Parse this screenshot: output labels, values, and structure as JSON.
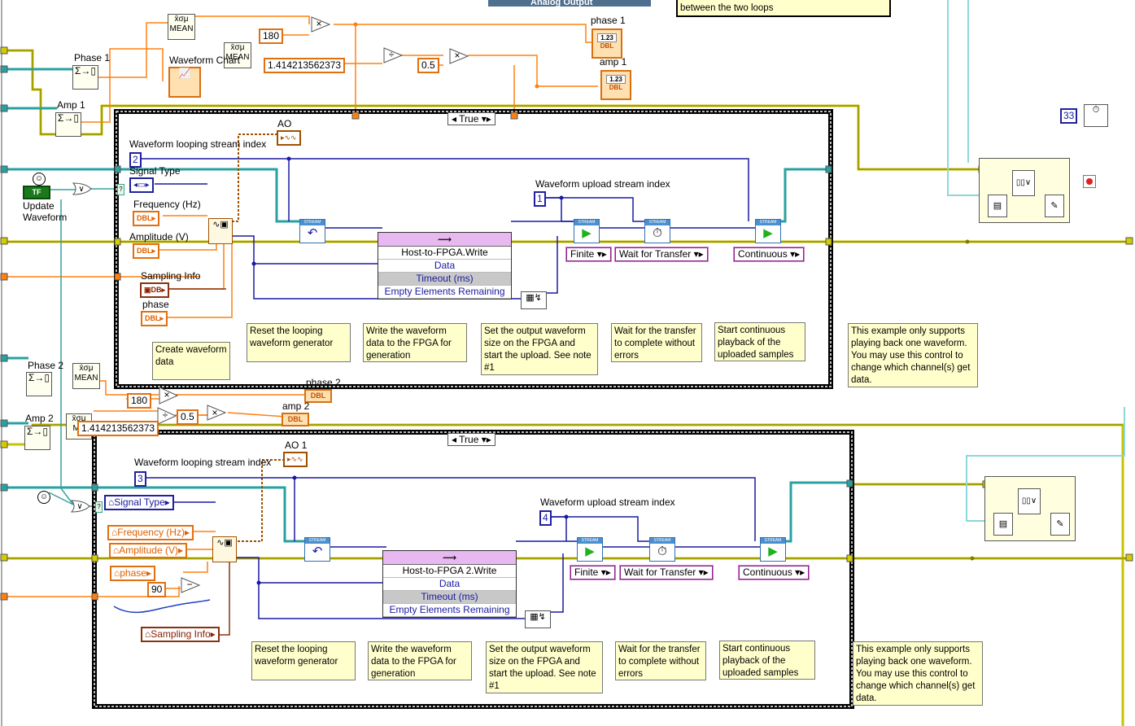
{
  "window": {
    "title": "Analog Output"
  },
  "top_comment": "between the two loops",
  "loop1": {
    "case_selector": "True",
    "phase_label": "Phase 1",
    "amp_label": "Amp 1",
    "mean_a": "MEAN",
    "mean_b": "MEAN",
    "waveform_chart_label": "Waveform Chart",
    "const_180": "180",
    "const_sqrt2": "1.414213562373",
    "const_half": "0.5",
    "phase_indicator": "phase 1",
    "amp_indicator": "amp 1",
    "ao_label": "AO",
    "looping_index_label": "Waveform looping stream index",
    "looping_index_value": "2",
    "signal_type_label": "Signal Type",
    "frequency_label": "Frequency (Hz)",
    "amplitude_label": "Amplitude (V)",
    "sampling_label": "Sampling Info",
    "phase_label_inner": "phase",
    "upload_index_label": "Waveform upload stream index",
    "upload_index_value": "1",
    "node_title": "Host-to-FPGA.Write",
    "node_rows": [
      "Data",
      "Timeout (ms)",
      "Empty Elements Remaining"
    ],
    "enum_finite": "Finite",
    "enum_wait": "Wait for Transfer",
    "enum_continuous": "Continuous",
    "update_waveform": "Update\nWaveform",
    "tf_text": "TF",
    "dbl": "DBL",
    "comments": {
      "create": "Create waveform data",
      "reset": "Reset the looping waveform generator",
      "write": "Write the waveform data to the FPGA for generation",
      "set": "Set the output waveform size on the FPGA and start the upload.   See note #1",
      "wait": "Wait for the transfer to complete without errors",
      "start": "Start continuous playback of the uploaded samples",
      "example": "This example only supports playing back one waveform. You may use this control to change which channel(s) get data."
    }
  },
  "loop2": {
    "case_selector": "True",
    "phase_label": "Phase 2",
    "amp_label": "Amp 2",
    "mean_a": "MEAN",
    "mean_b": "ME",
    "const_180": "180",
    "const_sqrt2": "1.414213562373",
    "const_half": "0.5",
    "const_90": "90",
    "phase_indicator": "phase 2",
    "amp_indicator": "amp 2",
    "ao_label": "AO 1",
    "looping_index_label": "Waveform looping stream index",
    "looping_index_value": "3",
    "signal_type_label": "Signal Type",
    "frequency_label": "Frequency (Hz)",
    "amplitude_label": "Amplitude (V)",
    "sampling_label": "Sampling Info",
    "phase_label_inner": "phase",
    "upload_index_label": "Waveform upload stream index",
    "upload_index_value": "4",
    "node_title": "Host-to-FPGA 2.Write",
    "node_rows": [
      "Data",
      "Timeout (ms)",
      "Empty Elements Remaining"
    ],
    "enum_finite": "Finite",
    "enum_wait": "Wait for Transfer",
    "enum_continuous": "Continuous",
    "comments": {
      "reset": "Reset the looping waveform generator",
      "write": "Write the waveform data to the FPGA for generation",
      "set": "Set the output waveform size on the FPGA and start the upload.   See note #1",
      "wait": "Wait for the transfer to complete without errors",
      "start": "Start continuous playback of the uploaded samples",
      "example": "This example only supports playing back one waveform. You may use this control to change which channel(s) get data."
    }
  },
  "timing": {
    "value": "33"
  },
  "colors": {
    "error_wire": "#c8c200",
    "dbl_wire": "#ff7f00",
    "int_wire": "#1a1aa0",
    "cluster_wire": "#8b2000",
    "refnum_wire": "#007f80",
    "waveform_wire": "#a05000"
  }
}
